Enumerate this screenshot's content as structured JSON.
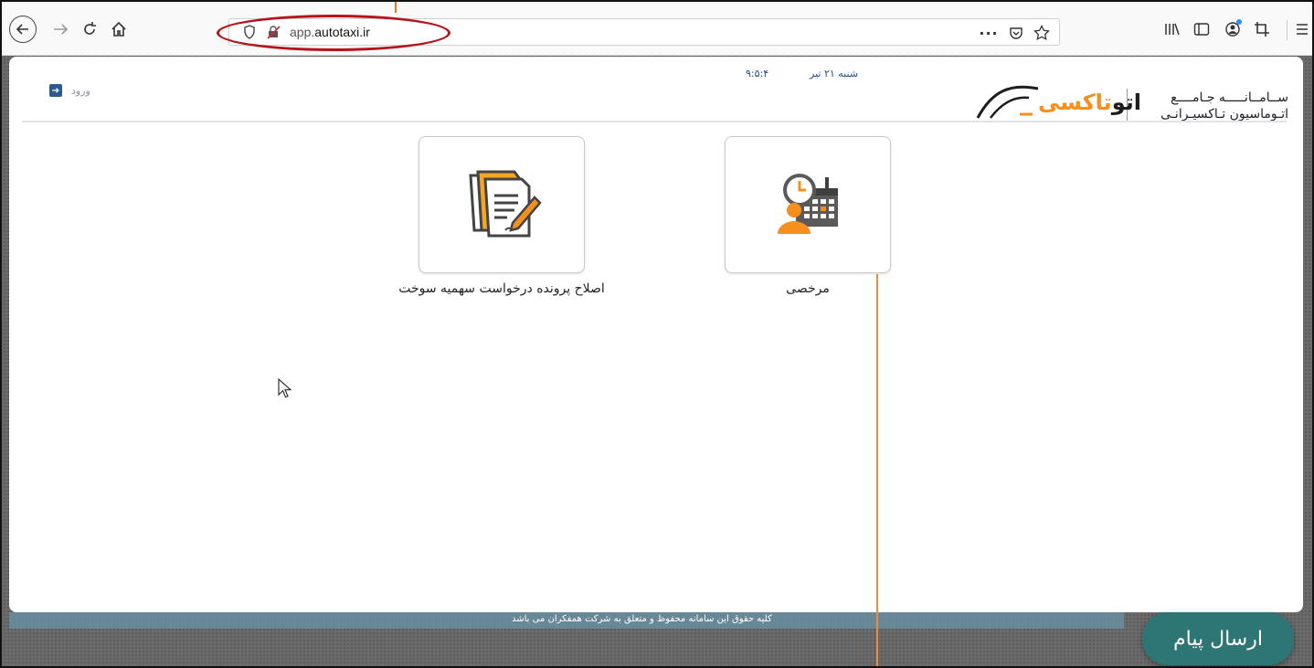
{
  "browser": {
    "url_prefix": "app.",
    "url_domain": "autotaxi.ir",
    "menu_dots": "···"
  },
  "header": {
    "login_label": "ورود",
    "date": "شنبه ۲۱ تیر",
    "time": "۹:۵:۴",
    "brand_line1": "ســامــانـــــه جـامــــع",
    "brand_line2": "اتـوماسيون تـاكسيـرانـی",
    "logo_dark": "اتو",
    "logo_orange": "تاکسی"
  },
  "tiles": [
    {
      "label": "مرخصی",
      "icon": "leave-calendar-icon"
    },
    {
      "label": "اصلاح پرونده درخواست سهمیه سوخت",
      "icon": "document-edit-icon"
    }
  ],
  "footer": {
    "copyright": "کلیه حقوق این سامانه محفوظ و متعلق به شرکت همفکران می باشد"
  },
  "send_message": {
    "label": "ارسال پیام"
  },
  "colors": {
    "accent_orange": "#f5901e",
    "send_button": "#2e7576",
    "annotation_red": "#b5141c",
    "annotation_orange": "#ec8d3e"
  }
}
